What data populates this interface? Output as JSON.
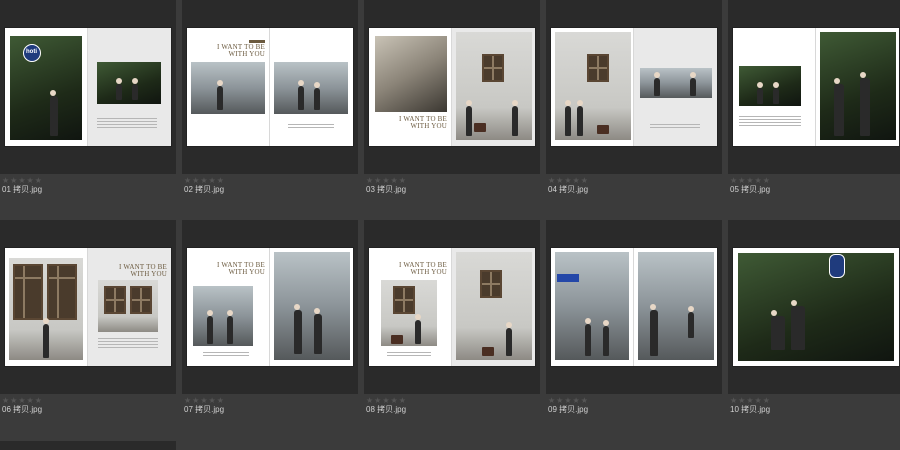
{
  "items": [
    {
      "rating": "★★★★★",
      "filename": "01 拷贝.jpg",
      "logo_text": "hoti"
    },
    {
      "rating": "★★★★★",
      "filename": "02 拷贝.jpg",
      "title": "I WANT TO BE\nWITH YOU"
    },
    {
      "rating": "★★★★★",
      "filename": "03 拷贝.jpg",
      "title": "I WANT TO BE\nWITH YOU"
    },
    {
      "rating": "★★★★★",
      "filename": "04 拷贝.jpg"
    },
    {
      "rating": "★★★★★",
      "filename": "05 拷贝.jpg"
    },
    {
      "rating": "★★★★★",
      "filename": "06 拷贝.jpg",
      "title": "I WANT TO BE\nWITH YOU"
    },
    {
      "rating": "★★★★★",
      "filename": "07 拷贝.jpg",
      "title": "I WANT TO BE\nWITH YOU"
    },
    {
      "rating": "★★★★★",
      "filename": "08 拷贝.jpg",
      "title": "I WANT TO BE\nWITH YOU"
    },
    {
      "rating": "★★★★★",
      "filename": "09 拷贝.jpg"
    },
    {
      "rating": "★★★★★",
      "filename": "10 拷贝.jpg"
    }
  ],
  "colors": {
    "background": "#3b3b3b",
    "thumb_box": "#2a2a2a",
    "title_gold": "#6b5a3f",
    "filename_text": "#d0d0d0",
    "rating_star": "#555555"
  },
  "icons": {
    "rating": "star-icon"
  }
}
